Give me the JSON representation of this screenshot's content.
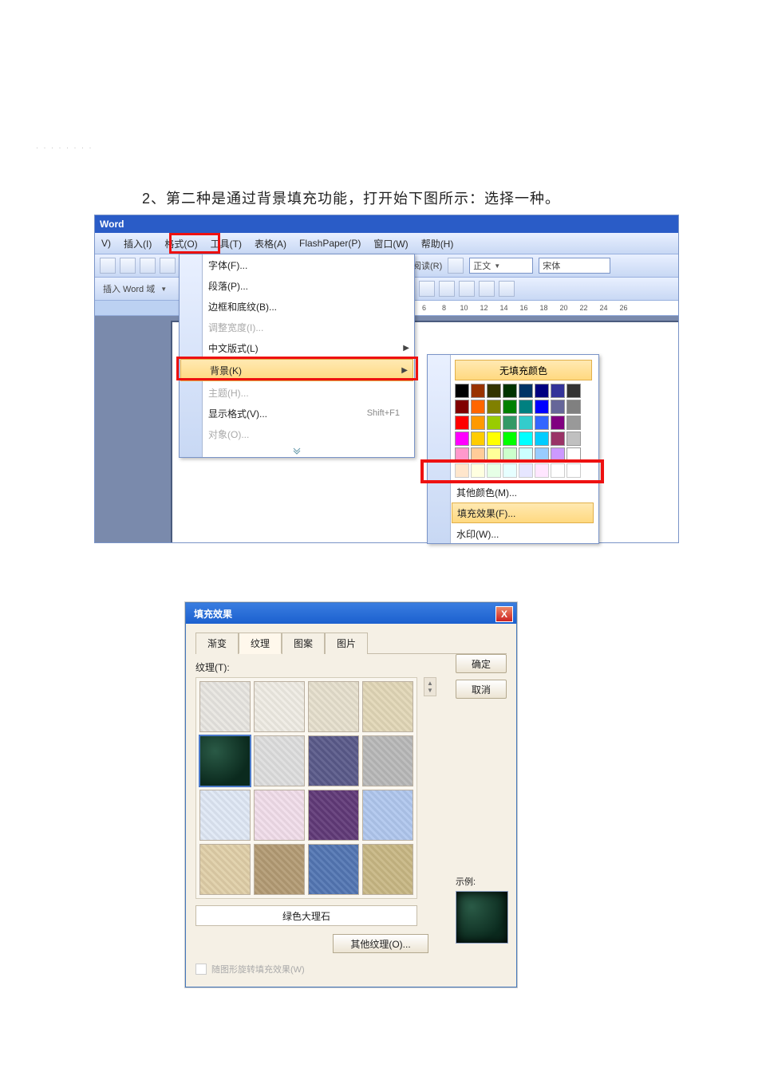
{
  "faint_header": "·  ·  · · ·  ·  · ·",
  "caption": "2、第二种是通过背景填充功能，打开始下图所示：选择一种。",
  "word": {
    "title": "Word",
    "menus": [
      "插入(I)",
      "格式(O)",
      "工具(T)",
      "表格(A)",
      "FlashPaper(P)",
      "窗口(W)",
      "帮助(H)"
    ],
    "toolbar_row1": {
      "reading": "阅读(R)",
      "style": "正文",
      "font": "宋体"
    },
    "toolbar_row2": {
      "label": "插入 Word 域"
    },
    "ruler": [
      "6",
      "8",
      "10",
      "12",
      "14",
      "16",
      "18",
      "20",
      "22",
      "24",
      "26"
    ],
    "format_menu": {
      "items": [
        {
          "label": "字体(F)...",
          "icon": "A"
        },
        {
          "label": "段落(P)..."
        },
        {
          "label": "边框和底纹(B)..."
        },
        {
          "label": "调整宽度(I)...",
          "disabled": true
        },
        {
          "label": "中文版式(L)",
          "arrow": true
        },
        {
          "label": "背景(K)",
          "arrow": true,
          "hl": true
        },
        {
          "label": "主题(H)...",
          "disabled": true
        },
        {
          "label": "显示格式(V)...",
          "kbd": "Shift+F1"
        },
        {
          "label": "对象(O)...",
          "disabled": true
        }
      ]
    },
    "bg_submenu": {
      "no_fill": "无填充颜色",
      "more_colors": "其他颜色(M)...",
      "fill_effects": "填充效果(F)...",
      "watermark": "水印(W)..."
    }
  },
  "colors": [
    "#000000",
    "#993300",
    "#333300",
    "#003300",
    "#003366",
    "#000080",
    "#333399",
    "#333333",
    "#800000",
    "#ff6600",
    "#808000",
    "#008000",
    "#008080",
    "#0000ff",
    "#666699",
    "#808080",
    "#ff0000",
    "#ff9900",
    "#99cc00",
    "#339966",
    "#33cccc",
    "#3366ff",
    "#800080",
    "#999999",
    "#ff00ff",
    "#ffcc00",
    "#ffff00",
    "#00ff00",
    "#00ffff",
    "#00ccff",
    "#993366",
    "#c0c0c0",
    "#ff99cc",
    "#ffcc99",
    "#ffff99",
    "#ccffcc",
    "#ccffff",
    "#99ccff",
    "#cc99ff",
    "#ffffff"
  ],
  "dialog": {
    "title": "填充效果",
    "close": "X",
    "tabs": [
      "渐变",
      "纹理",
      "图案",
      "图片"
    ],
    "tex_label": "纹理(T):",
    "selected_name": "绿色大理石",
    "other_tex": "其他纹理(O)...",
    "ok": "确定",
    "cancel": "取消",
    "preview_label": "示例:",
    "rotate_label": "随图形旋转填充效果(W)"
  },
  "textures": [
    "#e8e6e1",
    "#efece4",
    "#e6dfcd",
    "#e2d7b7",
    "#134e3a",
    "#dedede",
    "#5a5a8a",
    "#b8b8b8",
    "#dfe8f5",
    "#f1ddea",
    "#613a78",
    "#b0c7ee",
    "#e0cfa8",
    "#b39b74",
    "#5376b3",
    "#c8b784"
  ]
}
